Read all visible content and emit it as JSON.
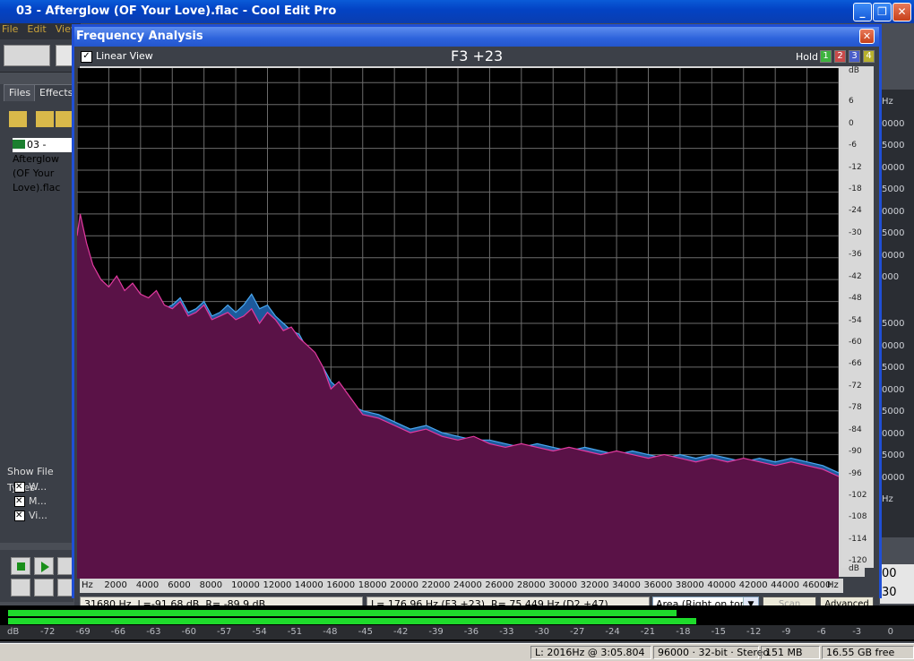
{
  "app": {
    "title": "03 - Afterglow (OF Your Love).flac - Cool Edit Pro",
    "menu": [
      "File",
      "Edit",
      "View"
    ],
    "tabs": [
      "Files",
      "Effects"
    ],
    "file_item": "03 - Afterglow (OF Your Love).flac",
    "show_file_types_label": "Show File Types",
    "file_types": [
      "W...",
      "M...",
      "Vi..."
    ]
  },
  "right_ruler": {
    "values_top": [
      "Hz",
      "0000",
      "5000",
      "0000",
      "5000",
      "0000",
      "5000",
      "0000",
      "000"
    ],
    "values_bottom": [
      "5000",
      "0000",
      "5000",
      "0000",
      "5000",
      "0000",
      "5000",
      "0000",
      "Hz"
    ],
    "fields": [
      "00",
      "30"
    ]
  },
  "dialog": {
    "title": "Frequency Analysis",
    "linear_view_label": "Linear View",
    "heading": "F3 +23",
    "hold_label": "Hold",
    "hold_buttons": [
      {
        "label": "1",
        "color": "#3fb23f"
      },
      {
        "label": "2",
        "color": "#c94a4a"
      },
      {
        "label": "3",
        "color": "#4a5ec9"
      },
      {
        "label": "4",
        "color": "#b7b02c"
      }
    ],
    "cursor_readout": "31680 Hz, L=-91.68 dB, R= -89.9 dB",
    "peak_readout": "L= 176.96 Hz (F3 +23), R= 75.449 Hz (D2 +47)",
    "view_mode": "Area (Right on top)",
    "scan_label": "Scan",
    "advanced_label": "Advanced"
  },
  "chart_data": {
    "type": "area",
    "x_unit": "Hz",
    "y_unit": "dB",
    "xlim": [
      0,
      48000
    ],
    "ylim": [
      -130,
      10
    ],
    "x_ticks": [
      "Hz",
      "2000",
      "4000",
      "6000",
      "8000",
      "10000",
      "12000",
      "14000",
      "16000",
      "18000",
      "20000",
      "22000",
      "24000",
      "26000",
      "28000",
      "30000",
      "32000",
      "34000",
      "36000",
      "38000",
      "40000",
      "42000",
      "44000",
      "46000",
      "Hz"
    ],
    "y_ticks": [
      "dB",
      "6",
      "0",
      "-6",
      "-12",
      "-18",
      "-24",
      "-30",
      "-36",
      "-42",
      "-48",
      "-54",
      "-60",
      "-66",
      "-72",
      "-78",
      "-84",
      "-90",
      "-96",
      "-102",
      "-108",
      "-114",
      "-120",
      "dB"
    ],
    "grid": true,
    "series": [
      {
        "name": "L",
        "fill": "#5a1247",
        "line": "#e23aa0",
        "x": [
          0,
          200,
          600,
          1000,
          1500,
          2000,
          2500,
          3000,
          3500,
          4000,
          4500,
          5000,
          5500,
          6000,
          6500,
          7000,
          7500,
          8000,
          8500,
          9000,
          9500,
          10000,
          10500,
          11000,
          11500,
          12000,
          12500,
          13000,
          13500,
          14000,
          14500,
          15000,
          15500,
          16000,
          16500,
          17000,
          17500,
          18000,
          19000,
          20000,
          21000,
          22000,
          23000,
          24000,
          25000,
          26000,
          27000,
          28000,
          29000,
          30000,
          31000,
          32000,
          33000,
          34000,
          35000,
          36000,
          37000,
          38000,
          39000,
          40000,
          41000,
          42000,
          43000,
          44000,
          45000,
          46000,
          47000,
          48000
        ],
        "values": [
          -36,
          -30,
          -38,
          -44,
          -48,
          -50,
          -47,
          -51,
          -49,
          -52,
          -53,
          -51,
          -55,
          -56,
          -54,
          -58,
          -57,
          -55,
          -59,
          -58,
          -57,
          -59,
          -58,
          -56,
          -60,
          -57,
          -59,
          -62,
          -61,
          -64,
          -66,
          -68,
          -72,
          -78,
          -76,
          -79,
          -82,
          -85,
          -86,
          -88,
          -90,
          -89,
          -91,
          -92,
          -91,
          -93,
          -94,
          -93,
          -94,
          -95,
          -94,
          -95,
          -96,
          -95,
          -96,
          -97,
          -96,
          -97,
          -98,
          -97,
          -98,
          -97,
          -98,
          -99,
          -98,
          -99,
          -100,
          -102
        ]
      },
      {
        "name": "R",
        "fill": "#1d5a9c",
        "line": "#4aa8f0",
        "x": [
          0,
          200,
          600,
          1000,
          1500,
          2000,
          2500,
          3000,
          3500,
          4000,
          4500,
          5000,
          5500,
          6000,
          6500,
          7000,
          7500,
          8000,
          8500,
          9000,
          9500,
          10000,
          10500,
          11000,
          11500,
          12000,
          12500,
          13000,
          13500,
          14000,
          14500,
          15000,
          15500,
          16000,
          16500,
          17000,
          17500,
          18000,
          19000,
          20000,
          21000,
          22000,
          23000,
          24000,
          25000,
          26000,
          27000,
          28000,
          29000,
          30000,
          31000,
          32000,
          33000,
          34000,
          35000,
          36000,
          37000,
          38000,
          39000,
          40000,
          41000,
          42000,
          43000,
          44000,
          45000,
          46000,
          47000,
          48000
        ],
        "values": [
          -38,
          -32,
          -40,
          -46,
          -50,
          -51,
          -49,
          -52,
          -50,
          -53,
          -54,
          -52,
          -56,
          -55,
          -53,
          -57,
          -56,
          -54,
          -58,
          -57,
          -55,
          -57,
          -55,
          -52,
          -56,
          -55,
          -58,
          -60,
          -62,
          -63,
          -67,
          -70,
          -72,
          -76,
          -78,
          -80,
          -83,
          -84,
          -85,
          -87,
          -89,
          -88,
          -90,
          -91,
          -92,
          -92,
          -93,
          -94,
          -93,
          -94,
          -95,
          -94,
          -95,
          -96,
          -95,
          -96,
          -97,
          -96,
          -97,
          -96,
          -97,
          -98,
          -97,
          -98,
          -97,
          -98,
          -99,
          -101
        ]
      }
    ]
  },
  "meter": {
    "scale": [
      "dB",
      "-72",
      "-69",
      "-66",
      "-63",
      "-60",
      "-57",
      "-54",
      "-51",
      "-48",
      "-45",
      "-42",
      "-39",
      "-36",
      "-33",
      "-30",
      "-27",
      "-24",
      "-21",
      "-18",
      "-15",
      "-12",
      "-9",
      "-6",
      "-3",
      "0"
    ]
  },
  "status": {
    "cursor": "L: 2016Hz @  3:05.804",
    "format": "96000 · 32-bit · Stereo",
    "size": "151 MB",
    "free": "16.55 GB free"
  }
}
